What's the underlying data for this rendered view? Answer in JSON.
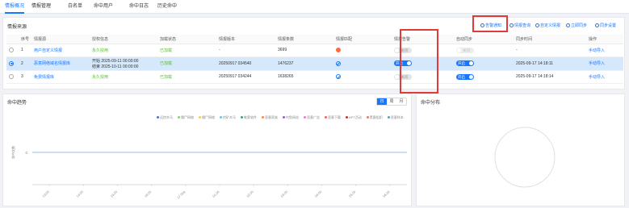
{
  "tabs": [
    "情报概况",
    "情报管理",
    "白名单",
    "命中用户",
    "命中日志",
    "历史命中"
  ],
  "active_tab": 0,
  "panel": {
    "title": "情报来源",
    "toolbar": [
      "告警通知",
      "情报查询",
      "自定义情报",
      "立即同步",
      "同步设置"
    ]
  },
  "table": {
    "columns": [
      "序号",
      "情报源",
      "授权信息",
      "加载状态",
      "情报版本",
      "情报条数",
      "情报匹配",
      "情报告警",
      "自动同步",
      "同步时间",
      "操作"
    ],
    "rows": [
      {
        "index": "1",
        "source": "用户自定义情报",
        "auth": [
          "永久授用"
        ],
        "load": "已加载",
        "version": "-",
        "count": "3699",
        "match": "warn",
        "alert": "关闭",
        "alert_on": false,
        "sync": "关闭",
        "sync_on": false,
        "sync_disabled": true,
        "sync_time": "-",
        "action": "手动导入",
        "selected": false
      },
      {
        "index": "2",
        "source": "恶意网络域名情报库",
        "auth": [
          "开始 2025-09-11 00:00:00",
          "结束 2025-10-11 00:00:00"
        ],
        "load": "已加载",
        "version": "20250917 034540",
        "count": "1476237",
        "match": "ok",
        "alert": "开启",
        "alert_on": true,
        "sync": "开启",
        "sync_on": true,
        "sync_disabled": false,
        "sync_time": "2025-09-17 14:18:11",
        "action": "手动导入",
        "selected": true
      },
      {
        "index": "3",
        "source": "免费情报库",
        "auth": [
          "永久授用"
        ],
        "load": "已加载",
        "version": "20250917 034244",
        "count": "1638265",
        "match": "ok",
        "alert": "关闭",
        "alert_on": false,
        "sync": "开启",
        "sync_on": true,
        "sync_disabled": false,
        "sync_time": "2025-09-17 14:18:14",
        "action": "手动导入",
        "selected": false
      }
    ]
  },
  "trend": {
    "title": "命中趋势",
    "seg": [
      "日",
      "周",
      "月"
    ],
    "seg_active": 0,
    "legend": [
      "远控木马",
      "僵尸网络",
      "僵尸网络",
      "挖矿木马",
      "勒索软件",
      "恶意家族",
      "钓鱼网站",
      "恶意广告",
      "恶意下载",
      "APT活动",
      "黑客组织",
      "恶意样本"
    ],
    "legend_colors": [
      "#5470c6",
      "#91cc75",
      "#fac858",
      "#73c0de",
      "#3ba272",
      "#fc8452",
      "#9a60b4",
      "#ea7ccc",
      "#ee6666",
      "#c23531",
      "#d48265",
      "#61a0a8"
    ],
    "ylabel": "命中次数",
    "ytick": "0",
    "xticks": [
      "13:00",
      "14:00",
      "15:00",
      "16:00",
      "17 Sep",
      "01:00",
      "02:00",
      "03:00",
      "04:00",
      "05:00",
      "06:00"
    ]
  },
  "distribution": {
    "title": "命中分布"
  }
}
